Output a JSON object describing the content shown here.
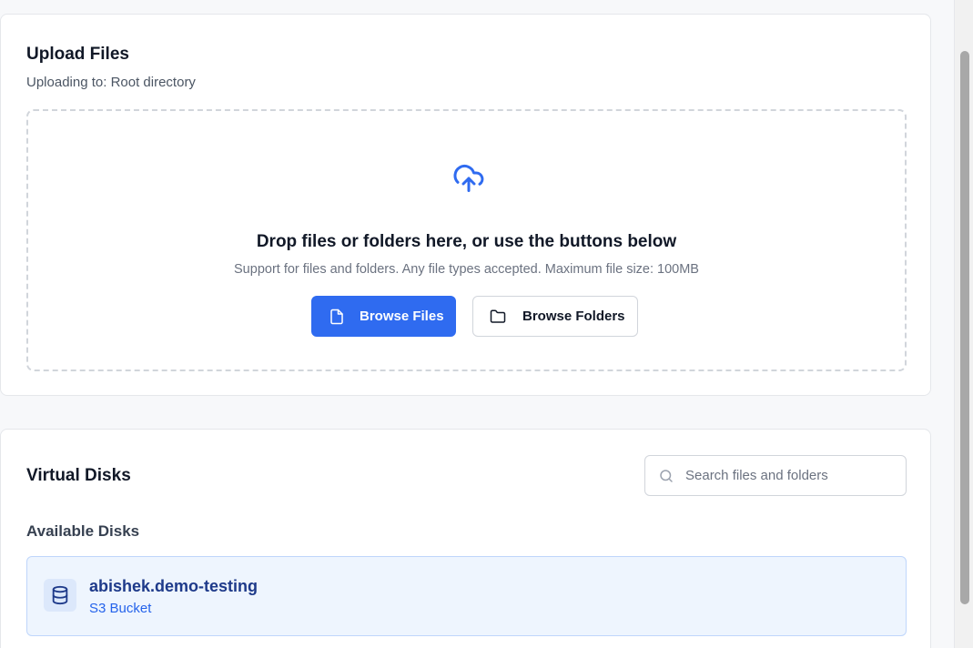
{
  "upload": {
    "title": "Upload Files",
    "subtitle": "Uploading to: Root directory",
    "drop_heading": "Drop files or folders here, or use the buttons below",
    "drop_subtext": "Support for files and folders. Any file types accepted. Maximum file size: 100MB",
    "browse_files_label": "Browse Files",
    "browse_folders_label": "Browse Folders",
    "upload_icon": "cloud-upload-icon",
    "file_icon": "file-icon",
    "folder_icon": "folder-icon"
  },
  "disks": {
    "title": "Virtual Disks",
    "search": {
      "placeholder": "Search files and folders",
      "value": "",
      "icon": "search-icon"
    },
    "section_label": "Available Disks",
    "items": [
      {
        "name": "abishek.demo-testing",
        "type": "S3 Bucket",
        "icon": "database-icon"
      }
    ]
  },
  "colors": {
    "accent": "#2f6bf0",
    "disk_bg": "#eef5fe",
    "disk_border": "#bfd6fb",
    "disk_name": "#1e3a8a",
    "disk_type": "#2563eb"
  }
}
